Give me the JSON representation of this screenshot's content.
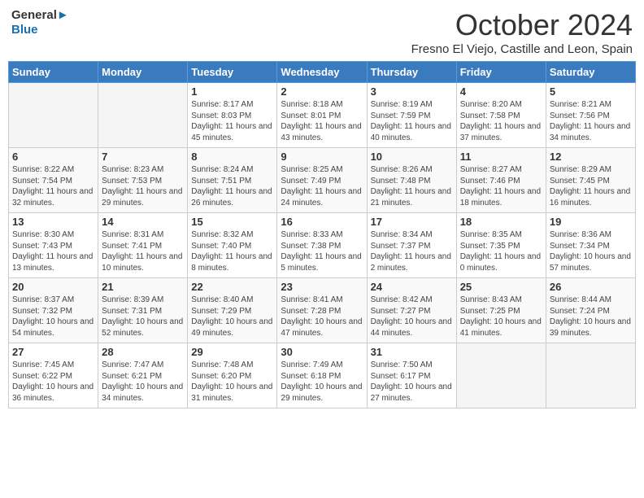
{
  "header": {
    "logo_line1": "General",
    "logo_line2": "Blue",
    "month": "October 2024",
    "location": "Fresno El Viejo, Castille and Leon, Spain"
  },
  "weekdays": [
    "Sunday",
    "Monday",
    "Tuesday",
    "Wednesday",
    "Thursday",
    "Friday",
    "Saturday"
  ],
  "weeks": [
    [
      {
        "day": "",
        "sunrise": "",
        "sunset": "",
        "daylight": "",
        "empty": true
      },
      {
        "day": "",
        "sunrise": "",
        "sunset": "",
        "daylight": "",
        "empty": true
      },
      {
        "day": "1",
        "sunrise": "Sunrise: 8:17 AM",
        "sunset": "Sunset: 8:03 PM",
        "daylight": "Daylight: 11 hours and 45 minutes."
      },
      {
        "day": "2",
        "sunrise": "Sunrise: 8:18 AM",
        "sunset": "Sunset: 8:01 PM",
        "daylight": "Daylight: 11 hours and 43 minutes."
      },
      {
        "day": "3",
        "sunrise": "Sunrise: 8:19 AM",
        "sunset": "Sunset: 7:59 PM",
        "daylight": "Daylight: 11 hours and 40 minutes."
      },
      {
        "day": "4",
        "sunrise": "Sunrise: 8:20 AM",
        "sunset": "Sunset: 7:58 PM",
        "daylight": "Daylight: 11 hours and 37 minutes."
      },
      {
        "day": "5",
        "sunrise": "Sunrise: 8:21 AM",
        "sunset": "Sunset: 7:56 PM",
        "daylight": "Daylight: 11 hours and 34 minutes."
      }
    ],
    [
      {
        "day": "6",
        "sunrise": "Sunrise: 8:22 AM",
        "sunset": "Sunset: 7:54 PM",
        "daylight": "Daylight: 11 hours and 32 minutes."
      },
      {
        "day": "7",
        "sunrise": "Sunrise: 8:23 AM",
        "sunset": "Sunset: 7:53 PM",
        "daylight": "Daylight: 11 hours and 29 minutes."
      },
      {
        "day": "8",
        "sunrise": "Sunrise: 8:24 AM",
        "sunset": "Sunset: 7:51 PM",
        "daylight": "Daylight: 11 hours and 26 minutes."
      },
      {
        "day": "9",
        "sunrise": "Sunrise: 8:25 AM",
        "sunset": "Sunset: 7:49 PM",
        "daylight": "Daylight: 11 hours and 24 minutes."
      },
      {
        "day": "10",
        "sunrise": "Sunrise: 8:26 AM",
        "sunset": "Sunset: 7:48 PM",
        "daylight": "Daylight: 11 hours and 21 minutes."
      },
      {
        "day": "11",
        "sunrise": "Sunrise: 8:27 AM",
        "sunset": "Sunset: 7:46 PM",
        "daylight": "Daylight: 11 hours and 18 minutes."
      },
      {
        "day": "12",
        "sunrise": "Sunrise: 8:29 AM",
        "sunset": "Sunset: 7:45 PM",
        "daylight": "Daylight: 11 hours and 16 minutes."
      }
    ],
    [
      {
        "day": "13",
        "sunrise": "Sunrise: 8:30 AM",
        "sunset": "Sunset: 7:43 PM",
        "daylight": "Daylight: 11 hours and 13 minutes."
      },
      {
        "day": "14",
        "sunrise": "Sunrise: 8:31 AM",
        "sunset": "Sunset: 7:41 PM",
        "daylight": "Daylight: 11 hours and 10 minutes."
      },
      {
        "day": "15",
        "sunrise": "Sunrise: 8:32 AM",
        "sunset": "Sunset: 7:40 PM",
        "daylight": "Daylight: 11 hours and 8 minutes."
      },
      {
        "day": "16",
        "sunrise": "Sunrise: 8:33 AM",
        "sunset": "Sunset: 7:38 PM",
        "daylight": "Daylight: 11 hours and 5 minutes."
      },
      {
        "day": "17",
        "sunrise": "Sunrise: 8:34 AM",
        "sunset": "Sunset: 7:37 PM",
        "daylight": "Daylight: 11 hours and 2 minutes."
      },
      {
        "day": "18",
        "sunrise": "Sunrise: 8:35 AM",
        "sunset": "Sunset: 7:35 PM",
        "daylight": "Daylight: 11 hours and 0 minutes."
      },
      {
        "day": "19",
        "sunrise": "Sunrise: 8:36 AM",
        "sunset": "Sunset: 7:34 PM",
        "daylight": "Daylight: 10 hours and 57 minutes."
      }
    ],
    [
      {
        "day": "20",
        "sunrise": "Sunrise: 8:37 AM",
        "sunset": "Sunset: 7:32 PM",
        "daylight": "Daylight: 10 hours and 54 minutes."
      },
      {
        "day": "21",
        "sunrise": "Sunrise: 8:39 AM",
        "sunset": "Sunset: 7:31 PM",
        "daylight": "Daylight: 10 hours and 52 minutes."
      },
      {
        "day": "22",
        "sunrise": "Sunrise: 8:40 AM",
        "sunset": "Sunset: 7:29 PM",
        "daylight": "Daylight: 10 hours and 49 minutes."
      },
      {
        "day": "23",
        "sunrise": "Sunrise: 8:41 AM",
        "sunset": "Sunset: 7:28 PM",
        "daylight": "Daylight: 10 hours and 47 minutes."
      },
      {
        "day": "24",
        "sunrise": "Sunrise: 8:42 AM",
        "sunset": "Sunset: 7:27 PM",
        "daylight": "Daylight: 10 hours and 44 minutes."
      },
      {
        "day": "25",
        "sunrise": "Sunrise: 8:43 AM",
        "sunset": "Sunset: 7:25 PM",
        "daylight": "Daylight: 10 hours and 41 minutes."
      },
      {
        "day": "26",
        "sunrise": "Sunrise: 8:44 AM",
        "sunset": "Sunset: 7:24 PM",
        "daylight": "Daylight: 10 hours and 39 minutes."
      }
    ],
    [
      {
        "day": "27",
        "sunrise": "Sunrise: 7:45 AM",
        "sunset": "Sunset: 6:22 PM",
        "daylight": "Daylight: 10 hours and 36 minutes."
      },
      {
        "day": "28",
        "sunrise": "Sunrise: 7:47 AM",
        "sunset": "Sunset: 6:21 PM",
        "daylight": "Daylight: 10 hours and 34 minutes."
      },
      {
        "day": "29",
        "sunrise": "Sunrise: 7:48 AM",
        "sunset": "Sunset: 6:20 PM",
        "daylight": "Daylight: 10 hours and 31 minutes."
      },
      {
        "day": "30",
        "sunrise": "Sunrise: 7:49 AM",
        "sunset": "Sunset: 6:18 PM",
        "daylight": "Daylight: 10 hours and 29 minutes."
      },
      {
        "day": "31",
        "sunrise": "Sunrise: 7:50 AM",
        "sunset": "Sunset: 6:17 PM",
        "daylight": "Daylight: 10 hours and 27 minutes."
      },
      {
        "day": "",
        "sunrise": "",
        "sunset": "",
        "daylight": "",
        "empty": true
      },
      {
        "day": "",
        "sunrise": "",
        "sunset": "",
        "daylight": "",
        "empty": true
      }
    ]
  ]
}
